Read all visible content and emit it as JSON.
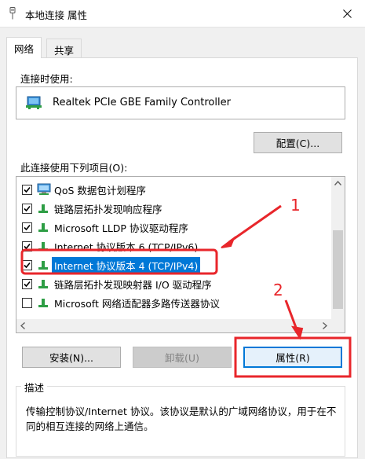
{
  "window": {
    "title": "本地连接 属性",
    "close_icon": "close-icon"
  },
  "tabs": [
    {
      "label": "网络",
      "active": true
    },
    {
      "label": "共享",
      "active": false
    }
  ],
  "connect_using": {
    "label": "连接时使用:",
    "adapter_name": "Realtek PCIe GBE Family Controller",
    "configure_button": "配置(C)..."
  },
  "items_section": {
    "label": "此连接使用下列项目(O):",
    "items": [
      {
        "label": "QoS 数据包计划程序",
        "checked": true,
        "icon": "qos-icon"
      },
      {
        "label": "链路层拓扑发现响应程序",
        "checked": true,
        "icon": "network-protocol-icon"
      },
      {
        "label": "Microsoft LLDP 协议驱动程序",
        "checked": true,
        "icon": "network-protocol-icon"
      },
      {
        "label": "Internet 协议版本 6 (TCP/IPv6)",
        "checked": true,
        "icon": "network-protocol-icon"
      },
      {
        "label": "Internet 协议版本 4 (TCP/IPv4)",
        "checked": true,
        "icon": "network-protocol-icon",
        "selected": true
      },
      {
        "label": "链路层拓扑发现映射器 I/O 驱动程序",
        "checked": true,
        "icon": "network-protocol-icon"
      },
      {
        "label": "Microsoft 网络适配器多路传送器协议",
        "checked": false,
        "icon": "network-protocol-icon"
      }
    ]
  },
  "buttons": {
    "install": "安装(N)...",
    "uninstall": "卸载(U)",
    "properties": "属性(R)"
  },
  "description": {
    "legend": "描述",
    "text": "传输控制协议/Internet 协议。该协议是默认的广域网络协议，用于在不同的相互连接的网络上通信。"
  },
  "annotations": {
    "marker_1": "1",
    "marker_2": "2",
    "color": "#e8262b"
  },
  "colors": {
    "selection": "#0078d7",
    "annotation_red": "#e8262b"
  }
}
